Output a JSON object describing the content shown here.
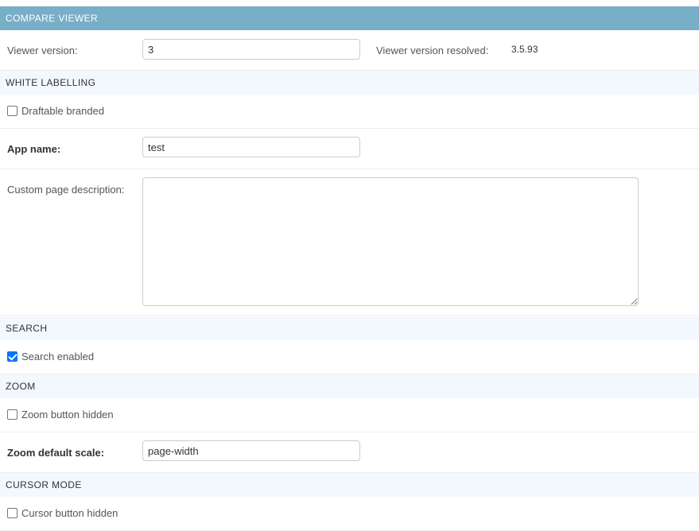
{
  "module": {
    "title": "COMPARE VIEWER"
  },
  "viewer": {
    "version_label": "Viewer version:",
    "version_value": "3",
    "resolved_label": "Viewer version resolved:",
    "resolved_value": "3.5.93"
  },
  "white_labelling": {
    "section_title": "WHITE LABELLING",
    "draftable_branded_label": "Draftable branded",
    "draftable_branded_checked": false,
    "app_name_label": "App name:",
    "app_name_value": "test",
    "custom_page_description_label": "Custom page description:",
    "custom_page_description_value": ""
  },
  "search": {
    "section_title": "SEARCH",
    "search_enabled_label": "Search enabled",
    "search_enabled_checked": true
  },
  "zoom": {
    "section_title": "ZOOM",
    "zoom_button_hidden_label": "Zoom button hidden",
    "zoom_button_hidden_checked": false,
    "zoom_default_scale_label": "Zoom default scale:",
    "zoom_default_scale_value": "page-width"
  },
  "cursor_mode": {
    "section_title": "CURSOR MODE",
    "cursor_button_hidden_label": "Cursor button hidden",
    "cursor_button_hidden_checked": false
  },
  "colors": {
    "module_header": "#79aec8",
    "section_bg": "#f2f8fd",
    "checkbox_checked": "#0075ff"
  }
}
